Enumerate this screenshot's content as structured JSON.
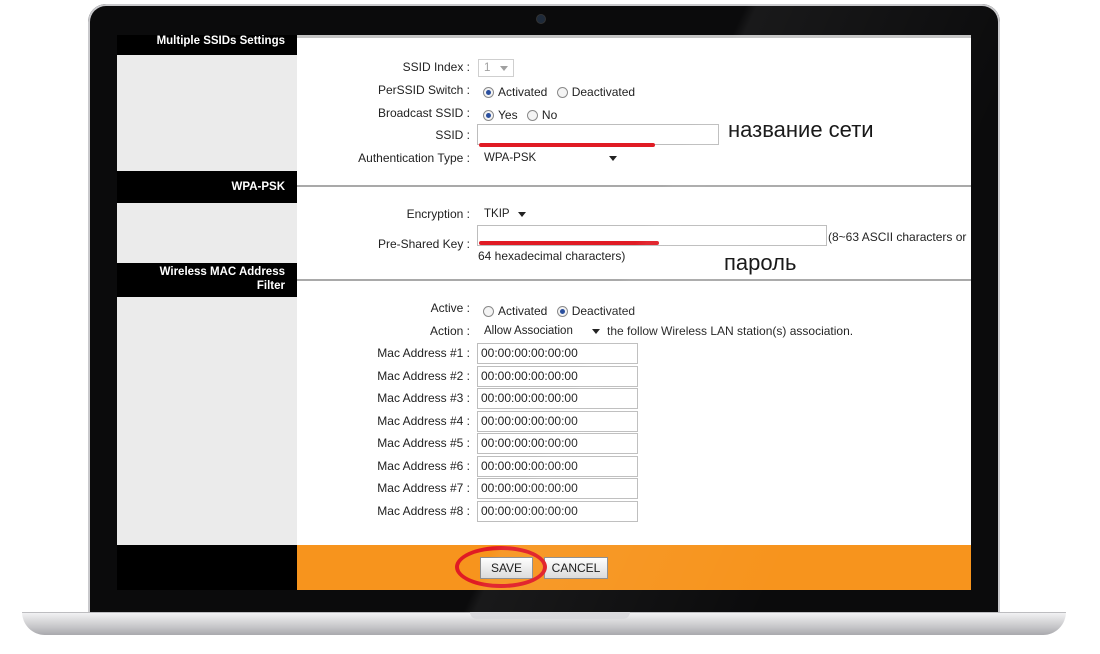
{
  "sections": {
    "multiple_ssids": "Multiple SSIDs Settings",
    "wpa_psk": "WPA-PSK",
    "mac_filter_line1": "Wireless MAC Address",
    "mac_filter_line2": "Filter"
  },
  "ssid_settings": {
    "ssid_index_label": "SSID Index :",
    "ssid_index_value": "1",
    "perssid_switch_label": "PerSSID Switch :",
    "activated": "Activated",
    "deactivated": "Deactivated",
    "perssid_selected": "Activated",
    "broadcast_label": "Broadcast SSID :",
    "yes": "Yes",
    "no": "No",
    "broadcast_selected": "Yes",
    "ssid_label": "SSID :",
    "ssid_value": "",
    "auth_label": "Authentication Type :",
    "auth_value": "WPA-PSK"
  },
  "wpa": {
    "encryption_label": "Encryption :",
    "encryption_value": "TKIP",
    "psk_label": "Pre-Shared Key :",
    "psk_value": "",
    "psk_hint_1": "(8~63 ASCII characters or",
    "psk_hint_2": "64 hexadecimal characters)"
  },
  "mac_filter": {
    "active_label": "Active :",
    "activated": "Activated",
    "deactivated": "Deactivated",
    "active_selected": "Deactivated",
    "action_label": "Action :",
    "action_value": "Allow Association",
    "action_suffix": "the follow Wireless LAN station(s) association.",
    "addresses": [
      {
        "label": "Mac Address #1 :",
        "value": "00:00:00:00:00:00"
      },
      {
        "label": "Mac Address #2 :",
        "value": "00:00:00:00:00:00"
      },
      {
        "label": "Mac Address #3 :",
        "value": "00:00:00:00:00:00"
      },
      {
        "label": "Mac Address #4 :",
        "value": "00:00:00:00:00:00"
      },
      {
        "label": "Mac Address #5 :",
        "value": "00:00:00:00:00:00"
      },
      {
        "label": "Mac Address #6 :",
        "value": "00:00:00:00:00:00"
      },
      {
        "label": "Mac Address #7 :",
        "value": "00:00:00:00:00:00"
      },
      {
        "label": "Mac Address #8 :",
        "value": "00:00:00:00:00:00"
      }
    ]
  },
  "buttons": {
    "save": "SAVE",
    "cancel": "CANCEL"
  },
  "annotations": {
    "network_name": "название сети",
    "password": "пароль"
  },
  "colors": {
    "footer": "#f7941d",
    "annotation_red": "#e01b24",
    "radio_selected": "#2a4f9e"
  }
}
